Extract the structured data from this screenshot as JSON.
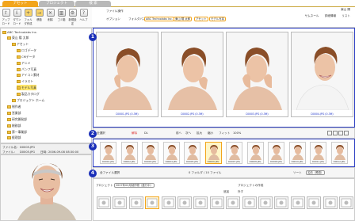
{
  "tabs": [
    "アセット",
    "プロジェクト",
    "検 索"
  ],
  "toolbar": {
    "buttons": [
      {
        "label": "アップロード",
        "icon": "upload-icon"
      },
      {
        "label": "ダウンロード",
        "icon": "download-icon"
      },
      {
        "label": "フォルダ作成",
        "icon": "folder-new-icon"
      },
      {
        "label": "移動",
        "icon": "move-icon"
      },
      {
        "label": "削除",
        "icon": "delete-icon"
      },
      {
        "label": "ゴミ箱",
        "icon": "trash-icon"
      },
      {
        "label": "新規設定",
        "icon": "settings-icon"
      },
      {
        "label": "ヘルプ",
        "icon": "help-icon"
      }
    ]
  },
  "header": {
    "user": "東山 陽",
    "links": [
      "ヘルプ"
    ],
    "menu_links": [
      "サムネール",
      "詳細情報",
      "リスト"
    ],
    "file_ops": "ファイル操作",
    "option": "オプション",
    "folder_path_label": "フォルダパス",
    "path": [
      "ABC Technolabs Inc.",
      "東山 陽 太郎",
      "アセット",
      "モデル写真"
    ]
  },
  "tree": {
    "root": "ABC Technolabs Inc.",
    "items": [
      {
        "label": "東山 陽 太郎",
        "level": 1
      },
      {
        "label": "アセット",
        "level": 2
      },
      {
        "label": "ロゴデータ",
        "level": 3
      },
      {
        "label": "CMデータ",
        "level": 3
      },
      {
        "label": "アニメ",
        "level": 3
      },
      {
        "label": "パンフ写真",
        "level": 3
      },
      {
        "label": "アイコン素材",
        "level": 3
      },
      {
        "label": "イラスト",
        "level": 3
      },
      {
        "label": "モデル写真",
        "level": 3,
        "selected": true
      },
      {
        "label": "製品カタログ",
        "level": 3
      },
      {
        "label": "プロジェクト ホーム",
        "level": 2
      },
      {
        "label": "制作者",
        "level": 1
      },
      {
        "label": "営業部",
        "level": 1
      },
      {
        "label": "研究開発部",
        "level": 1
      },
      {
        "label": "総務部",
        "level": 1
      },
      {
        "label": "第一事業部",
        "level": 1
      },
      {
        "label": "経理部",
        "level": 1
      }
    ]
  },
  "file_info": {
    "name_label": "ファイル名：",
    "name": "D0005.JPG",
    "size_label": "ファイル：",
    "size": "D0005.JPG",
    "date_label": "日時：",
    "date": "2006-09-08 08:30:00"
  },
  "viewer": {
    "badge": "1",
    "photos": [
      {
        "caption": "D0001.JPG (0.3M)"
      },
      {
        "caption": "D0002.JPG (0.3M)"
      },
      {
        "caption": "D0003.JPG (0.3M)"
      },
      {
        "caption": "D0004.JPG (0.3M)"
      }
    ]
  },
  "viewer_bar": {
    "all_select": "全選択",
    "cancel": "解除",
    "download": "DL",
    "prev": "前へ",
    "next": "次へ",
    "zoom_in": "拡大",
    "zoom_out": "縮小",
    "fit": "フィット",
    "zoom": "100%"
  },
  "badges": {
    "two": "2",
    "three": "3",
    "four": "4"
  },
  "strip": {
    "thumbs": [
      "D0001.JPG",
      "D0002.JPG",
      "D0003.JPG",
      "D0004.JPG",
      "D0005.JPG",
      "D0006.JPG",
      "D0007.JPG",
      "D0008.JPG",
      "D0009.JPG",
      "D0010.JPG",
      "D0011.JPG",
      "D0012.JPG"
    ]
  },
  "strip_bar": {
    "all_files": "全ファイル選択",
    "count": "0 フォルダ / 10 ファイル",
    "sort_label": "ソート",
    "sort_value": "名前（昇順）"
  },
  "project": {
    "label": "プロジェクト",
    "select_value": "2007年03月制作物（進行中）",
    "make": "プロジェクトの作成",
    "add": "追加",
    "remove": "外す"
  },
  "colors": {
    "accent": "#f2a51c",
    "badge": "#1a2fb8",
    "border_blue": "#2b3cc2"
  }
}
